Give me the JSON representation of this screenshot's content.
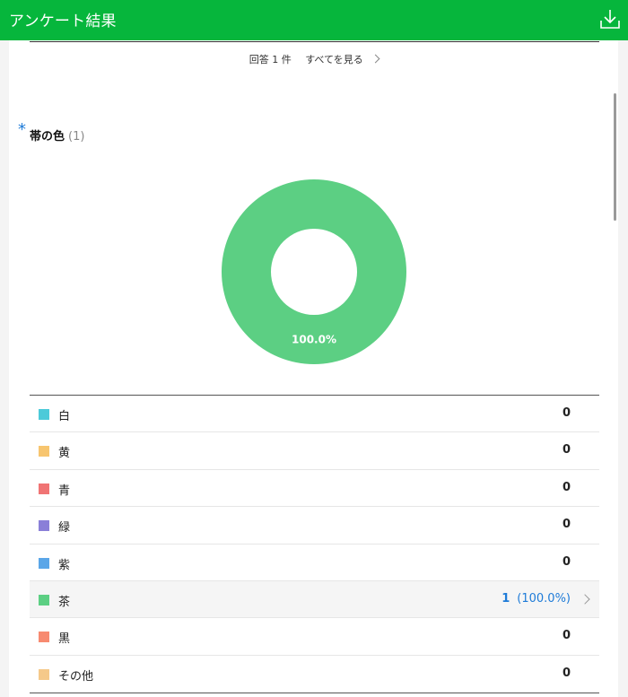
{
  "header": {
    "title": "アンケート結果",
    "download_icon": "download-icon",
    "color": "#06b63c"
  },
  "summary": {
    "responses_text": "回答 1 件",
    "see_all_label": "すべてを見る"
  },
  "question": {
    "required_mark": "*",
    "title": "帯の色",
    "count": "(1)"
  },
  "chart_data": {
    "type": "pie",
    "categories": [
      "白",
      "黄",
      "青",
      "緑",
      "紫",
      "茶",
      "黒",
      "その他"
    ],
    "values": [
      0,
      0,
      0,
      0,
      0,
      1,
      0,
      0
    ],
    "colors": [
      "#4ccad9",
      "#f7c56f",
      "#f07474",
      "#8a7fd8",
      "#5aa6e8",
      "#5ccf83",
      "#f78a70",
      "#f5c98a"
    ],
    "data_labels": [
      "",
      "",
      "",
      "",
      "",
      "100.0%",
      "",
      ""
    ],
    "donut": true
  },
  "legend": [
    {
      "label": "白",
      "value": "0",
      "color": "#4ccad9"
    },
    {
      "label": "黄",
      "value": "0",
      "color": "#f7c56f"
    },
    {
      "label": "青",
      "value": "0",
      "color": "#f07474"
    },
    {
      "label": "緑",
      "value": "0",
      "color": "#8a7fd8"
    },
    {
      "label": "紫",
      "value": "0",
      "color": "#5aa6e8"
    },
    {
      "label": "茶",
      "value": "1",
      "percent": "(100.0%)",
      "color": "#5ccf83",
      "highlight": true
    },
    {
      "label": "黒",
      "value": "0",
      "color": "#f78a70"
    },
    {
      "label": "その他",
      "value": "0",
      "color": "#f5c98a"
    }
  ]
}
